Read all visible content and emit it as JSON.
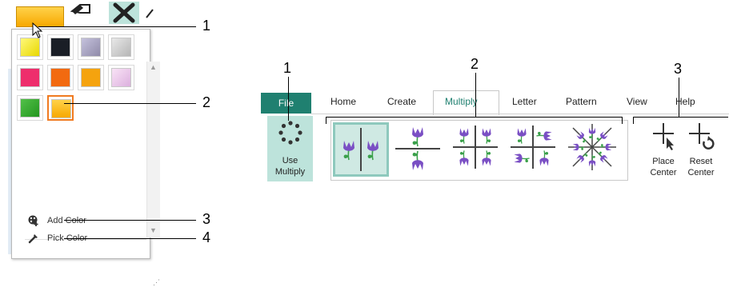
{
  "colors": {
    "accent": "#1f8070",
    "selected_border": "#f07a20",
    "active_bg": "#bde3db",
    "flower_purple": "#7a4fc4",
    "leaf_green": "#3aa04a"
  },
  "color_picker": {
    "swatches": [
      {
        "name": "yellow",
        "color": "linear-gradient(135deg,#fff87a,#e8d800)"
      },
      {
        "name": "black",
        "color": "#1a1e26"
      },
      {
        "name": "lavender-gray",
        "color": "linear-gradient(135deg,#c5c2dd,#8f8aa8)"
      },
      {
        "name": "light-gray",
        "color": "linear-gradient(135deg,#e8e8e8,#b5b5b5)"
      },
      {
        "name": "pink",
        "color": "#ee2e6c"
      },
      {
        "name": "orange",
        "color": "#f26a10"
      },
      {
        "name": "amber",
        "color": "#f5a30e"
      },
      {
        "name": "light-pink",
        "color": "linear-gradient(135deg,#f9e3f6,#dcb0de)"
      },
      {
        "name": "green",
        "color": "linear-gradient(135deg,#53c049,#23961f)"
      },
      {
        "name": "gold",
        "color": "linear-gradient(180deg,#ffd24a,#f7a800)"
      }
    ],
    "selected_index": 9,
    "menu": [
      {
        "label": "Add Color",
        "icon": "palette-plus-icon"
      },
      {
        "label": "Pick Color",
        "icon": "eyedropper-icon"
      }
    ]
  },
  "callouts_left": [
    "1",
    "2",
    "3",
    "4"
  ],
  "ribbon": {
    "file_tab": "File",
    "tabs": [
      "Home",
      "Create",
      "Multiply",
      "Letter",
      "Pattern",
      "View",
      "Help"
    ],
    "active_tab": "Multiply",
    "use_multiply": {
      "line1": "Use",
      "line2": "Multiply",
      "icon": "dotted-circle-icon"
    },
    "gallery": [
      "two-way-vertical",
      "two-way-horizontal",
      "four-way",
      "four-way-alt",
      "eight-way"
    ],
    "gallery_selected": 0,
    "commands": [
      {
        "line1": "Place",
        "line2": "Center",
        "icon": "place-center-icon"
      },
      {
        "line1": "Reset",
        "line2": "Center",
        "icon": "reset-center-icon"
      }
    ],
    "callouts": [
      "1",
      "2",
      "3"
    ]
  }
}
